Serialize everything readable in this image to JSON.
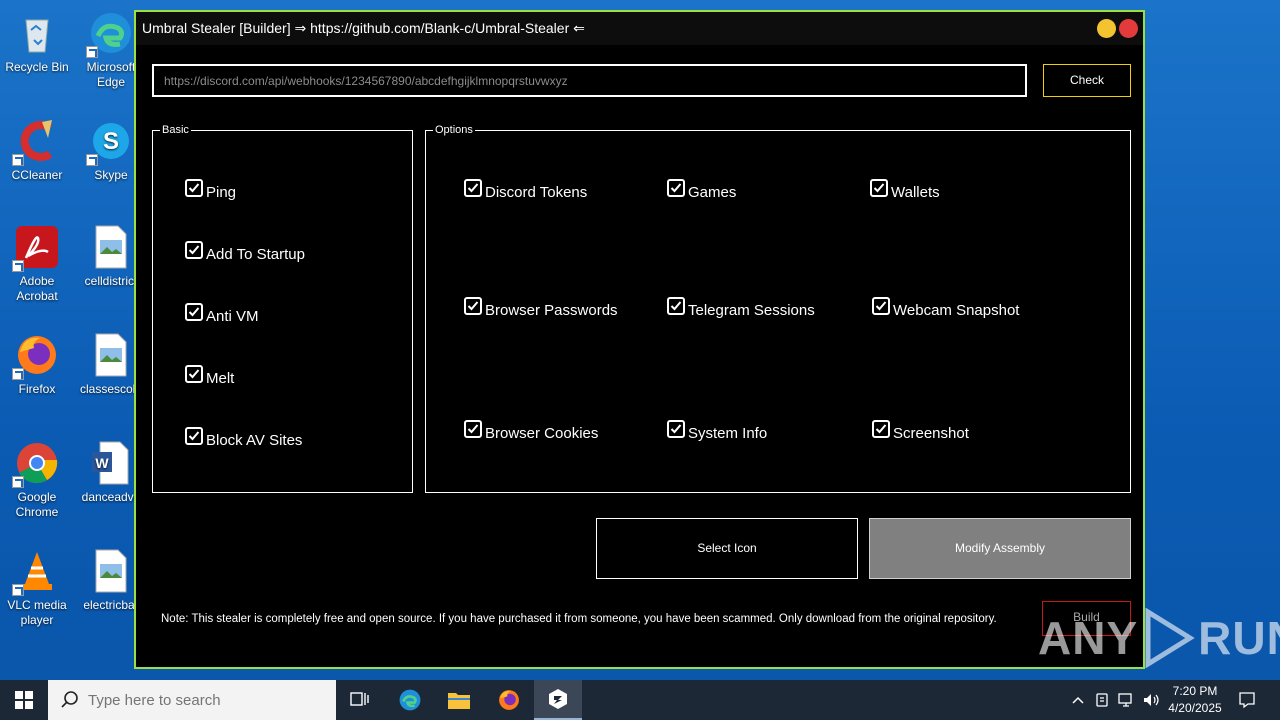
{
  "desktop": {
    "icons": [
      {
        "label": "Recycle Bin"
      },
      {
        "label": "Microsoft Edge"
      },
      {
        "label": "CCleaner"
      },
      {
        "label": "Skype"
      },
      {
        "label": "Adobe Acrobat"
      },
      {
        "label": "celldistrict"
      },
      {
        "label": "Firefox"
      },
      {
        "label": "classescolo"
      },
      {
        "label": "Google Chrome"
      },
      {
        "label": "danceadve"
      },
      {
        "label": "VLC media player"
      },
      {
        "label": "electricbar"
      }
    ]
  },
  "window": {
    "title": "Umbral Stealer [Builder] ⇒ https://github.com/Blank-c/Umbral-Stealer ⇐",
    "webhook_value": "https://discord.com/api/webhooks/1234567890/abcdefhgijklmnopqrstuvwxyz",
    "check_label": "Check",
    "basic": {
      "legend": "Basic",
      "items": [
        {
          "label": "Ping",
          "checked": true
        },
        {
          "label": "Add To Startup",
          "checked": true
        },
        {
          "label": "Anti VM",
          "checked": true
        },
        {
          "label": "Melt",
          "checked": true
        },
        {
          "label": "Block AV Sites",
          "checked": true
        }
      ]
    },
    "options": {
      "legend": "Options",
      "items": [
        {
          "label": "Discord Tokens",
          "checked": true
        },
        {
          "label": "Games",
          "checked": true
        },
        {
          "label": "Wallets",
          "checked": true
        },
        {
          "label": "Browser Passwords",
          "checked": true
        },
        {
          "label": "Telegram Sessions",
          "checked": true
        },
        {
          "label": "Webcam Snapshot",
          "checked": true
        },
        {
          "label": "Browser Cookies",
          "checked": true
        },
        {
          "label": "System Info",
          "checked": true
        },
        {
          "label": "Screenshot",
          "checked": true
        }
      ]
    },
    "select_icon_label": "Select Icon",
    "modify_assembly_label": "Modify Assembly",
    "note": "Note: This stealer is completely free and open source. If you have purchased it from someone, you have been scammed. Only download from the original repository.",
    "build_label": "Build",
    "colors": {
      "border": "#9be03c",
      "check_border": "#f0d000",
      "build_border": "#c41818"
    }
  },
  "watermark": {
    "left": "ANY",
    "right": "RUN"
  },
  "taskbar": {
    "search_placeholder": "Type here to search",
    "time": "7:20 PM",
    "date": "4/20/2025"
  }
}
